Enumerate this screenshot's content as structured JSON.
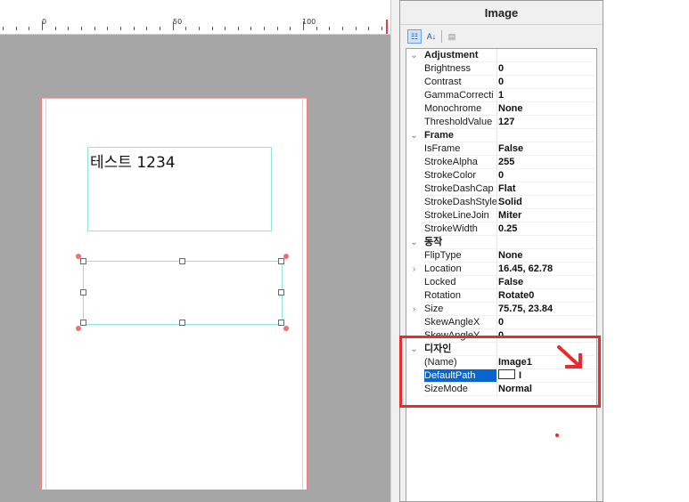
{
  "ruler": {
    "marks": [
      "0",
      "50",
      "100"
    ]
  },
  "design": {
    "text_element": "테스트 1234"
  },
  "panel": {
    "title": "Image",
    "toolbar": [
      "categorized-icon",
      "alphabetical-icon",
      "property-pages-icon"
    ],
    "categories": {
      "adjustment": "Adjustment",
      "frame": "Frame",
      "behavior": "동작",
      "design": "디자인"
    },
    "props": {
      "brightness": {
        "name": "Brightness",
        "value": "0"
      },
      "contrast": {
        "name": "Contrast",
        "value": "0"
      },
      "gamma": {
        "name": "GammaCorrecti",
        "value": "1"
      },
      "monochrome": {
        "name": "Monochrome",
        "value": "None"
      },
      "threshold": {
        "name": "ThresholdValue",
        "value": "127"
      },
      "isframe": {
        "name": "IsFrame",
        "value": "False"
      },
      "strokealpha": {
        "name": "StrokeAlpha",
        "value": "255"
      },
      "strokecolor": {
        "name": "StrokeColor",
        "value": "0"
      },
      "strokedashcap": {
        "name": "StrokeDashCap",
        "value": "Flat"
      },
      "strokedashstyle": {
        "name": "StrokeDashStyle",
        "value": "Solid"
      },
      "strokelinejoin": {
        "name": "StrokeLineJoin",
        "value": "Miter"
      },
      "strokewidth": {
        "name": "StrokeWidth",
        "value": "0.25"
      },
      "fliptype": {
        "name": "FlipType",
        "value": "None"
      },
      "location": {
        "name": "Location",
        "value": "16.45, 62.78"
      },
      "locked": {
        "name": "Locked",
        "value": "False"
      },
      "rotation": {
        "name": "Rotation",
        "value": "Rotate0"
      },
      "size": {
        "name": "Size",
        "value": "75.75, 23.84"
      },
      "skewx": {
        "name": "SkewAngleX",
        "value": "0"
      },
      "skewy": {
        "name": "SkewAngleY",
        "value": "0"
      },
      "objname": {
        "name": "(Name)",
        "value": "Image1"
      },
      "defaultpath": {
        "name": "DefaultPath",
        "value": "I",
        "button": "..."
      },
      "sizemode": {
        "name": "SizeMode",
        "value": "Normal"
      }
    }
  },
  "colors": {
    "accent_selection": "#0a64cf",
    "annotation": "#e62c2c",
    "guide": "#8de8d8"
  }
}
